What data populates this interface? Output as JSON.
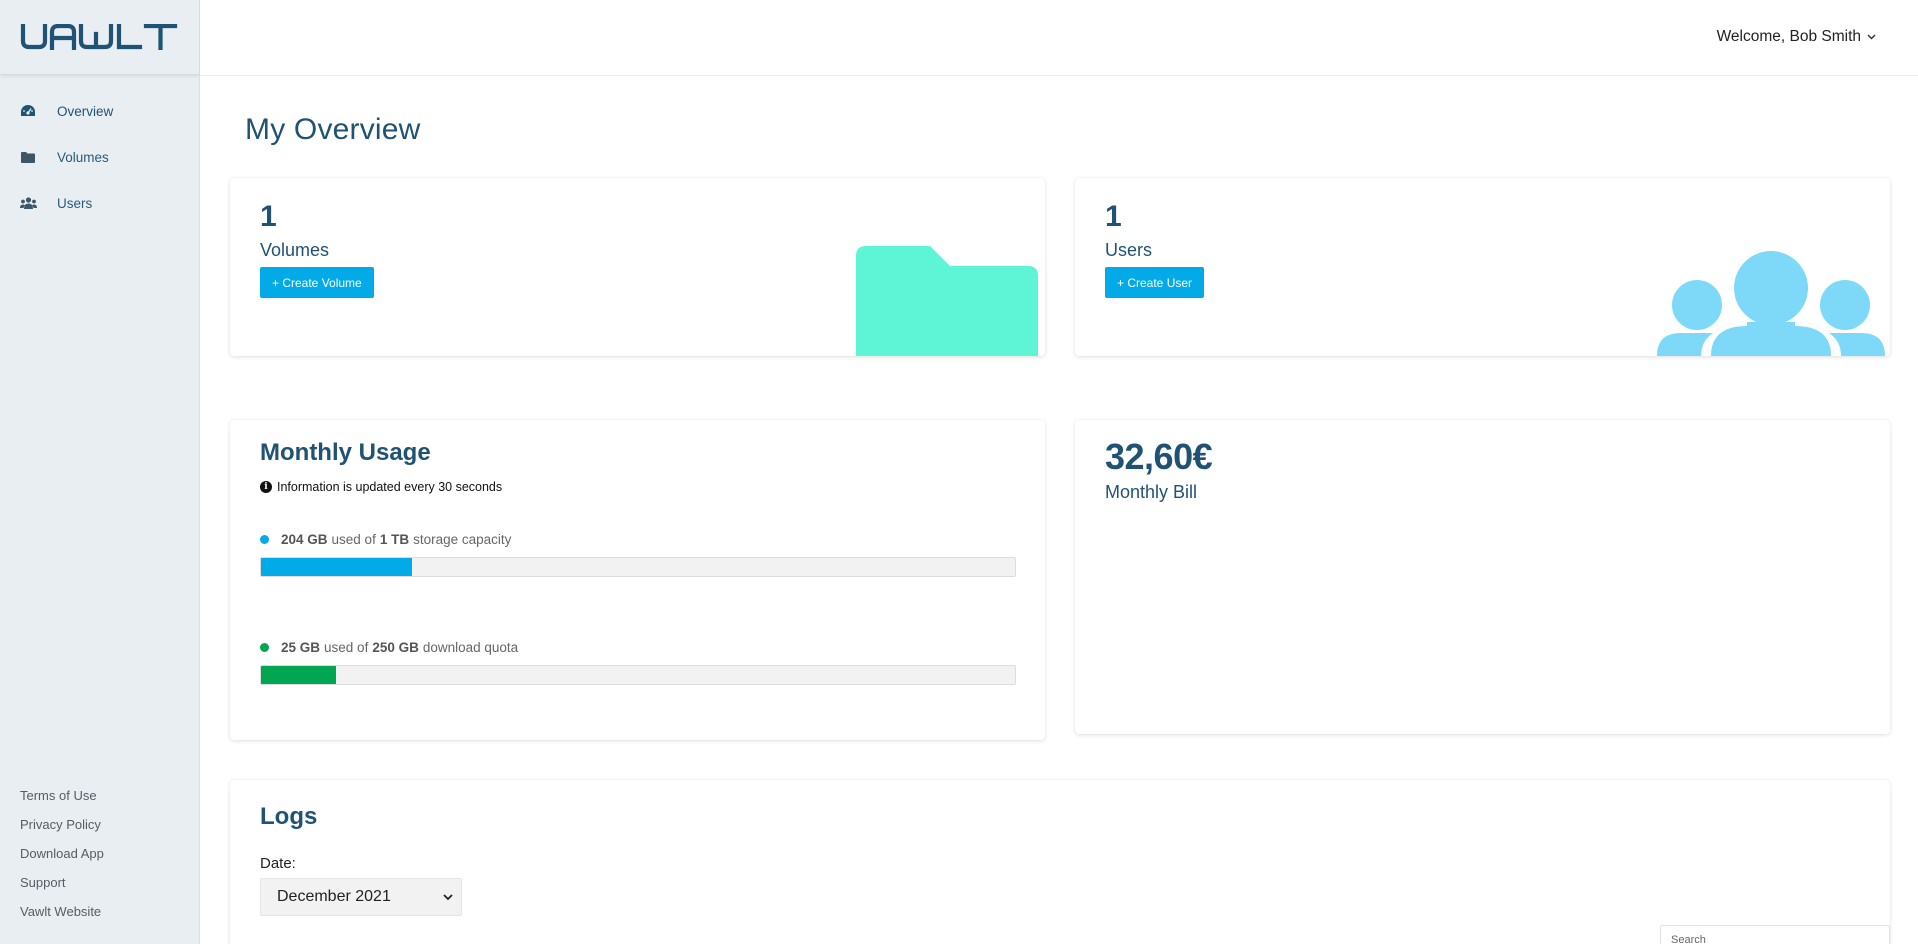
{
  "app": {
    "logo_text": "VAWLT",
    "accent_color": "#03aae8",
    "title_color": "#1f5273"
  },
  "sidebar": {
    "items": [
      {
        "label": "Overview",
        "icon": "dashboard-icon",
        "active": true
      },
      {
        "label": "Volumes",
        "icon": "folder-icon",
        "active": false
      },
      {
        "label": "Users",
        "icon": "users-icon",
        "active": false
      }
    ],
    "footer_links": [
      "Terms of Use",
      "Privacy Policy",
      "Download App",
      "Support",
      "Vawlt Website"
    ]
  },
  "header": {
    "welcome": "Welcome, Bob Smith"
  },
  "main": {
    "title": "My Overview",
    "volumes_card": {
      "count": "1",
      "label": "Volumes",
      "button": "+ Create Volume",
      "illustration": "folder-illustration",
      "illustration_color": "#5ef5d6"
    },
    "users_card": {
      "count": "1",
      "label": "Users",
      "button": "+ Create User",
      "illustration": "users-illustration",
      "illustration_color": "#7dd9f7"
    },
    "usage_card": {
      "title": "Monthly Usage",
      "info": "Information is updated every 30 seconds",
      "storage": {
        "used": "204 GB",
        "mid": "used of",
        "total": "1 TB",
        "suffix": "storage capacity",
        "fraction": 0.2,
        "color": "#03aae8"
      },
      "download": {
        "used": "25 GB",
        "mid": "used of",
        "total": "250 GB",
        "suffix": "download quota",
        "fraction": 0.1,
        "color": "#00a651"
      }
    },
    "bill_card": {
      "amount": "32,60€",
      "label": "Monthly Bill"
    },
    "logs_card": {
      "title": "Logs",
      "date_label": "Date:",
      "date_value": "December 2021",
      "search_placeholder": "Search"
    }
  }
}
